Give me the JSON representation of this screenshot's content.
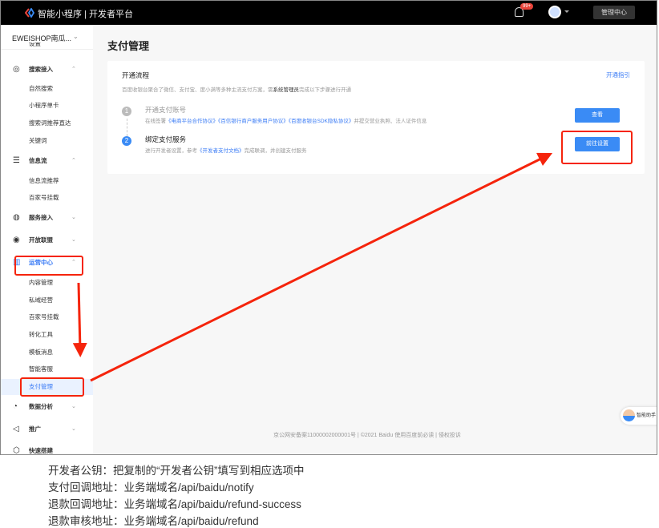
{
  "header": {
    "brand": "智能小程序 | 开发者平台",
    "badge": "99+",
    "admin_button": "管理中心"
  },
  "sidebar": {
    "app_name": "EWEISHOP南瓜...",
    "cut_item": "设置",
    "items": [
      {
        "label": "搜索接入",
        "type": "group",
        "icon": "search-icon",
        "chev": "^"
      },
      {
        "label": "自然搜索"
      },
      {
        "label": "小程序单卡"
      },
      {
        "label": "搜索词推荐直达"
      },
      {
        "label": "关键词"
      },
      {
        "label": "信息流",
        "type": "group",
        "icon": "feed-icon",
        "chev": "^"
      },
      {
        "label": "信息流推荐"
      },
      {
        "label": "百家号挂载"
      },
      {
        "label": "服务接入",
        "type": "group",
        "icon": "service-icon",
        "chev": "v"
      },
      {
        "label": "开放联盟",
        "type": "group",
        "icon": "alliance-icon",
        "chev": "v"
      },
      {
        "label": "运营中心",
        "type": "group",
        "icon": "operation-icon",
        "chev": "^"
      },
      {
        "label": "内容管理"
      },
      {
        "label": "私域经营"
      },
      {
        "label": "百家号挂载"
      },
      {
        "label": "转化工具"
      },
      {
        "label": "模板消息"
      },
      {
        "label": "智能客服"
      },
      {
        "label": "支付管理",
        "active": true
      },
      {
        "label": "数据分析",
        "type": "group",
        "icon": "chart-icon",
        "chev": "v"
      },
      {
        "label": "推广",
        "type": "group",
        "icon": "megaphone-icon",
        "chev": "v"
      },
      {
        "label": "快速搭建",
        "type": "group",
        "icon": "cube-icon",
        "chev": ""
      }
    ]
  },
  "main": {
    "title": "支付管理",
    "card": {
      "heading": "开通流程",
      "guide_link": "开通指引",
      "desc_pre": "百度收银台聚合了微信、支付宝、度小满等多种主流支付方案，需",
      "desc_bold": "系统管理员",
      "desc_post": "完成以下步骤进行开通",
      "steps": [
        {
          "num": "1",
          "title": "开通支付账号",
          "desc_pre": "在线签署",
          "links": [
            "《电商平台合作协议》",
            "《百信银行商户服务用户协议》",
            "《百度收银台SDK隐私协议》"
          ],
          "desc_post": "并提交营业执照、法人证件信息",
          "button": "查看"
        },
        {
          "num": "2",
          "title": "绑定支付服务",
          "desc_pre": "进行开发者设置，参考",
          "links": [
            "《开发者支付文档》"
          ],
          "desc_post": "完成联调，并创建支付服务",
          "button": "前往设置"
        }
      ]
    }
  },
  "footer": "京公网安备案11000002000001号  |  ©2021 Baidu 使用百度前必读  | 侵权投诉",
  "helper": "智能助手",
  "notes": [
    "开发者公钥：把复制的“开发者公钥”填写到相应选项中",
    "支付回调地址：业务端域名/api/baidu/notify",
    "退款回调地址：业务端域名/api/baidu/refund-success",
    "退款审核地址：业务端域名/api/baidu/refund"
  ],
  "colors": {
    "accent": "#3a8bf5",
    "annotation": "#f5240c"
  }
}
